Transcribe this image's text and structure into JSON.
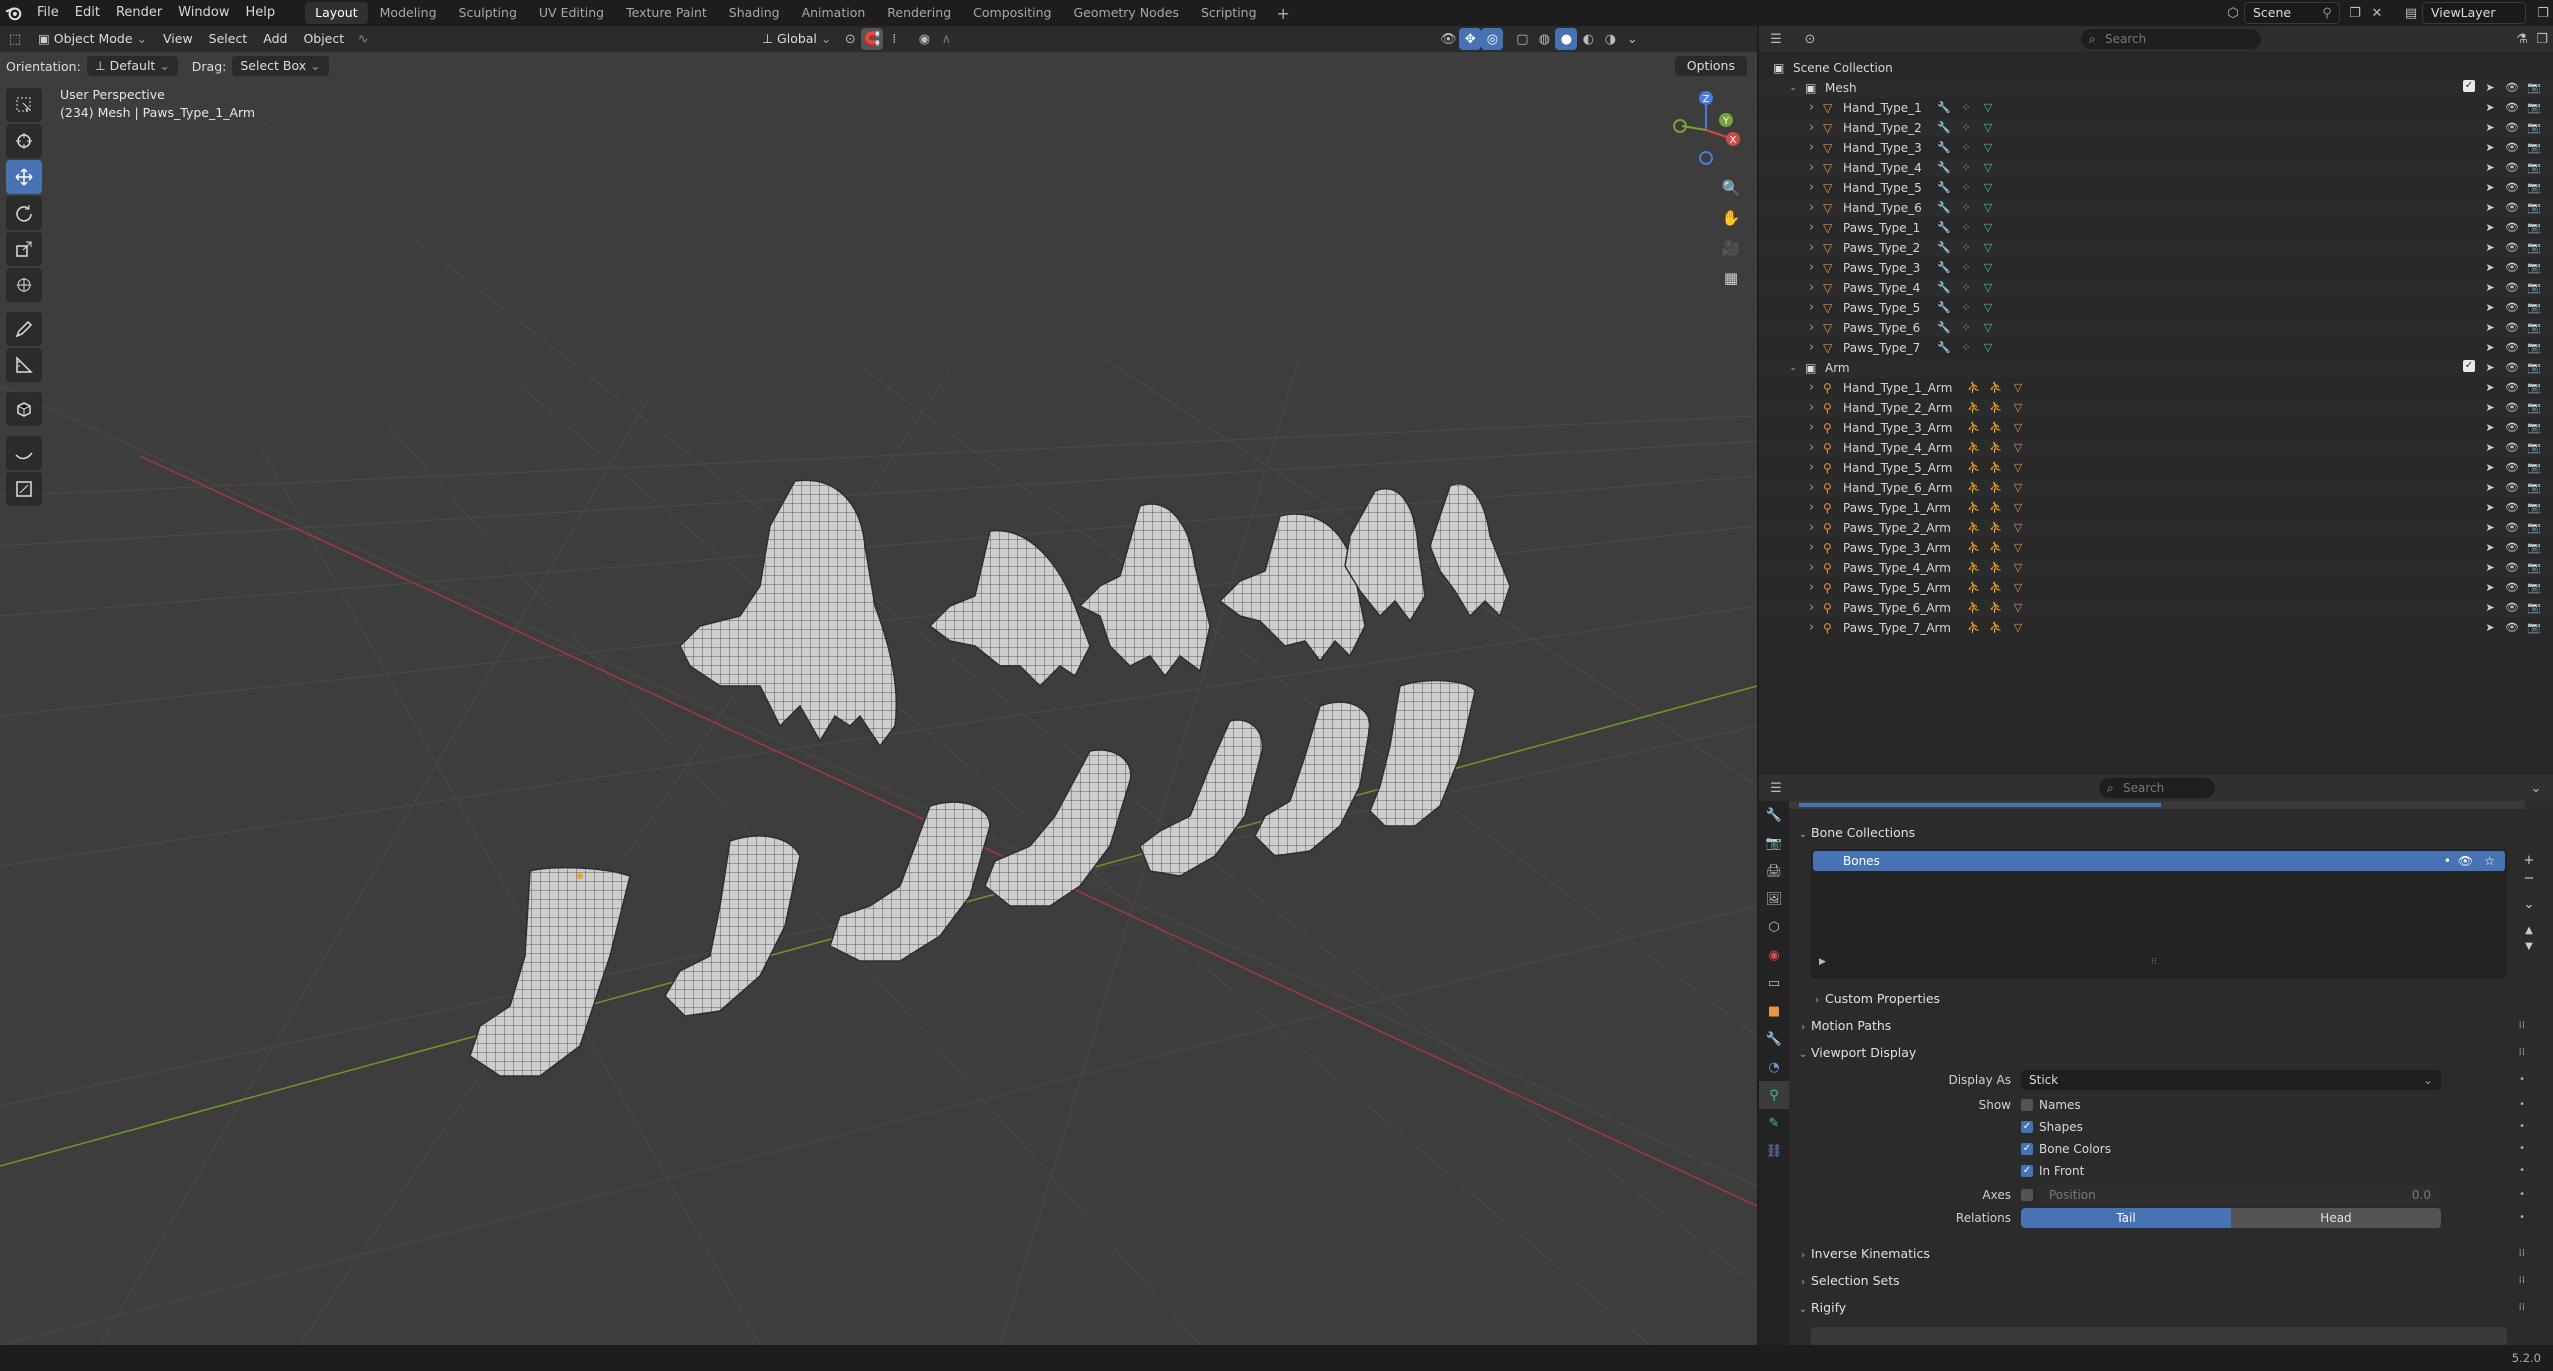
{
  "menubar": {
    "menus": [
      "File",
      "Edit",
      "Render",
      "Window",
      "Help"
    ],
    "workspaces": [
      "Layout",
      "Modeling",
      "Sculpting",
      "UV Editing",
      "Texture Paint",
      "Shading",
      "Animation",
      "Rendering",
      "Compositing",
      "Geometry Nodes",
      "Scripting"
    ],
    "active_workspace": "Layout",
    "add_label": "+",
    "scene_name": "Scene",
    "view_layer": "ViewLayer"
  },
  "viewport": {
    "mode": "Object Mode",
    "menus": [
      "View",
      "Select",
      "Add",
      "Object"
    ],
    "transform_orientation": "Global",
    "orientation_label": "Orientation:",
    "orientation_value": "Default",
    "drag_label": "Drag:",
    "drag_value": "Select Box",
    "options_label": "Options",
    "info_line1": "User Perspective",
    "info_line2": "(234) Mesh | Paws_Type_1_Arm",
    "gizmo_axes": {
      "x": "X",
      "y": "Y",
      "z": "Z"
    }
  },
  "outliner": {
    "search_placeholder": "Search",
    "root": "Scene Collection",
    "collections": [
      {
        "name": "Mesh",
        "items": [
          "Hand_Type_1",
          "Hand_Type_2",
          "Hand_Type_3",
          "Hand_Type_4",
          "Hand_Type_5",
          "Hand_Type_6",
          "Paws_Type_1",
          "Paws_Type_2",
          "Paws_Type_3",
          "Paws_Type_4",
          "Paws_Type_5",
          "Paws_Type_6",
          "Paws_Type_7"
        ]
      },
      {
        "name": "Arm",
        "items": [
          "Hand_Type_1_Arm",
          "Hand_Type_2_Arm",
          "Hand_Type_3_Arm",
          "Hand_Type_4_Arm",
          "Hand_Type_5_Arm",
          "Hand_Type_6_Arm",
          "Paws_Type_1_Arm",
          "Paws_Type_2_Arm",
          "Paws_Type_3_Arm",
          "Paws_Type_4_Arm",
          "Paws_Type_5_Arm",
          "Paws_Type_6_Arm",
          "Paws_Type_7_Arm"
        ]
      }
    ]
  },
  "properties": {
    "search_placeholder": "Search",
    "bone_collections_title": "Bone Collections",
    "bone_collection_item": "Bones",
    "custom_properties": "Custom Properties",
    "motion_paths": "Motion Paths",
    "viewport_display": "Viewport Display",
    "display_as_label": "Display As",
    "display_as_value": "Stick",
    "show_label": "Show",
    "show_options": [
      {
        "label": "Names",
        "checked": false
      },
      {
        "label": "Shapes",
        "checked": true
      },
      {
        "label": "Bone Colors",
        "checked": true
      },
      {
        "label": "In Front",
        "checked": true
      }
    ],
    "axes_label": "Axes",
    "axes_position_label": "Position",
    "axes_position_value": "0.0",
    "relations_label": "Relations",
    "relations_options": [
      "Tail",
      "Head"
    ],
    "relations_active": "Tail",
    "inverse_kinematics": "Inverse Kinematics",
    "selection_sets": "Selection Sets",
    "rigify": "Rigify"
  },
  "status": {
    "version": "5.2.0"
  },
  "colors": {
    "accent": "#4772b3",
    "viewport_bg": "#3d3d3d",
    "x_axis": "#c0393f",
    "y_axis": "#6a9a2a",
    "mesh_icon": "#e8944a",
    "modifier_icon": "#6e93d6",
    "data_icon": "#3ec08e"
  }
}
